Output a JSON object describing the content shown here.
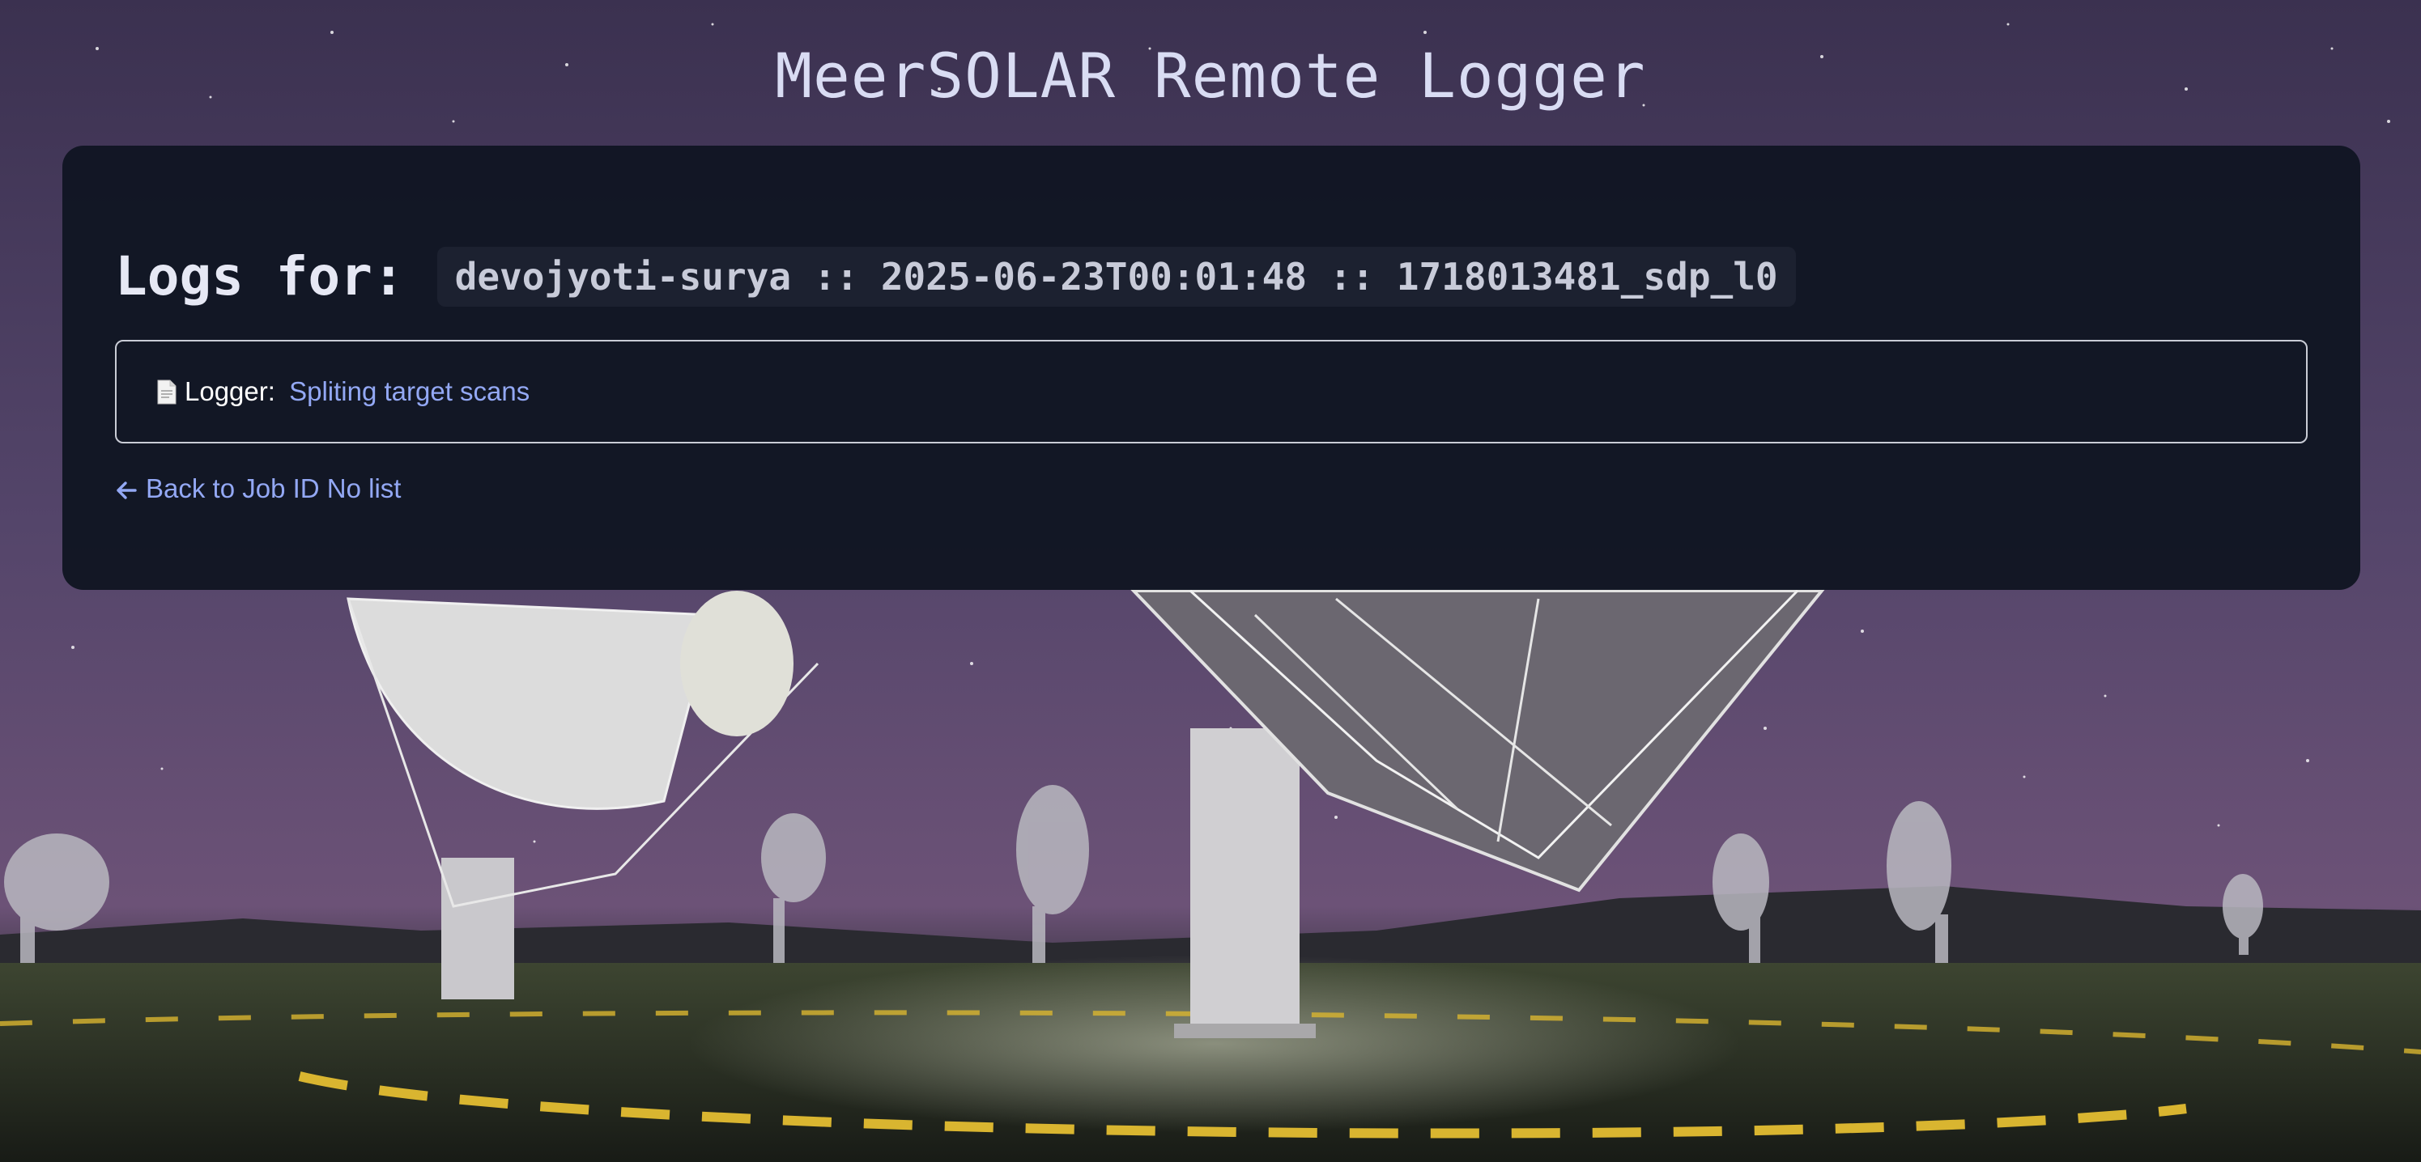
{
  "header": {
    "title": "MeerSOLAR Remote Logger"
  },
  "logs": {
    "heading_label": "Logs for:",
    "job_identifier": "devojyoti-surya :: 2025-06-23T00:01:48 :: 1718013481_sdp_l0"
  },
  "logger_entry": {
    "icon": "document-icon",
    "prefix": "Logger: ",
    "link_label": "Spliting target scans"
  },
  "navigation": {
    "back_icon": "left-arrow-icon",
    "back_label": "Back to Job ID No list"
  },
  "colors": {
    "card_background": "#111623",
    "link": "#93a8f4",
    "title": "#d9dcf3"
  }
}
